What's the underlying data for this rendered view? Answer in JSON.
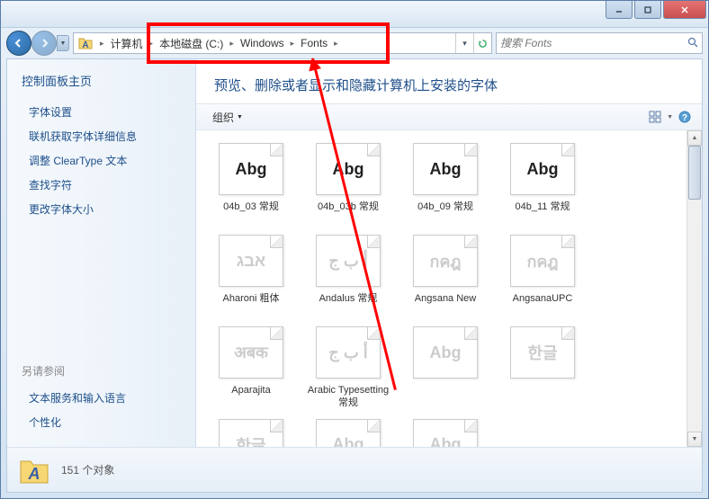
{
  "window_controls": {
    "min": "minimize",
    "max": "maximize",
    "close": "close"
  },
  "breadcrumb": [
    {
      "label": "计算机"
    },
    {
      "label": "本地磁盘 (C:)"
    },
    {
      "label": "Windows"
    },
    {
      "label": "Fonts"
    }
  ],
  "search": {
    "placeholder": "搜索 Fonts"
  },
  "sidebar": {
    "title": "控制面板主页",
    "links": [
      "字体设置",
      "联机获取字体详细信息",
      "调整 ClearType 文本",
      "查找字符",
      "更改字体大小"
    ],
    "see_also_title": "另请参阅",
    "see_also": [
      "文本服务和输入语言",
      "个性化"
    ]
  },
  "main": {
    "title": "预览、删除或者显示和隐藏计算机上安装的字体"
  },
  "toolbar": {
    "organize": "组织"
  },
  "fonts": [
    {
      "label": "04b_03 常规",
      "sample": "Abg",
      "stack": false,
      "dim": false
    },
    {
      "label": "04b_03b 常规",
      "sample": "Abg",
      "stack": false,
      "dim": false
    },
    {
      "label": "04b_09 常规",
      "sample": "Abg",
      "stack": false,
      "dim": false
    },
    {
      "label": "04b_11 常规",
      "sample": "Abg",
      "stack": false,
      "dim": false
    },
    {
      "label": "Aharoni 粗体",
      "sample": "אבג",
      "stack": false,
      "dim": true
    },
    {
      "label": "Andalus 常规",
      "sample": "أ ب ج",
      "stack": false,
      "dim": true
    },
    {
      "label": "Angsana New",
      "sample": "กคฎ",
      "stack": true,
      "dim": true
    },
    {
      "label": "AngsanaUPC",
      "sample": "กคฎ",
      "stack": true,
      "dim": true
    },
    {
      "label": "Aparajita",
      "sample": "अबक",
      "stack": true,
      "dim": true
    },
    {
      "label": "Arabic Typesetting 常规",
      "sample": "أ ب ج",
      "stack": false,
      "dim": true
    },
    {
      "label": "",
      "sample": "Abg",
      "stack": true,
      "dim": true
    },
    {
      "label": "",
      "sample": "한글",
      "stack": true,
      "dim": true
    },
    {
      "label": "",
      "sample": "한글",
      "stack": true,
      "dim": true
    },
    {
      "label": "",
      "sample": "Abg",
      "stack": true,
      "dim": true
    },
    {
      "label": "",
      "sample": "Abg",
      "stack": false,
      "dim": true
    }
  ],
  "status": {
    "count_text": "151 个对象"
  }
}
